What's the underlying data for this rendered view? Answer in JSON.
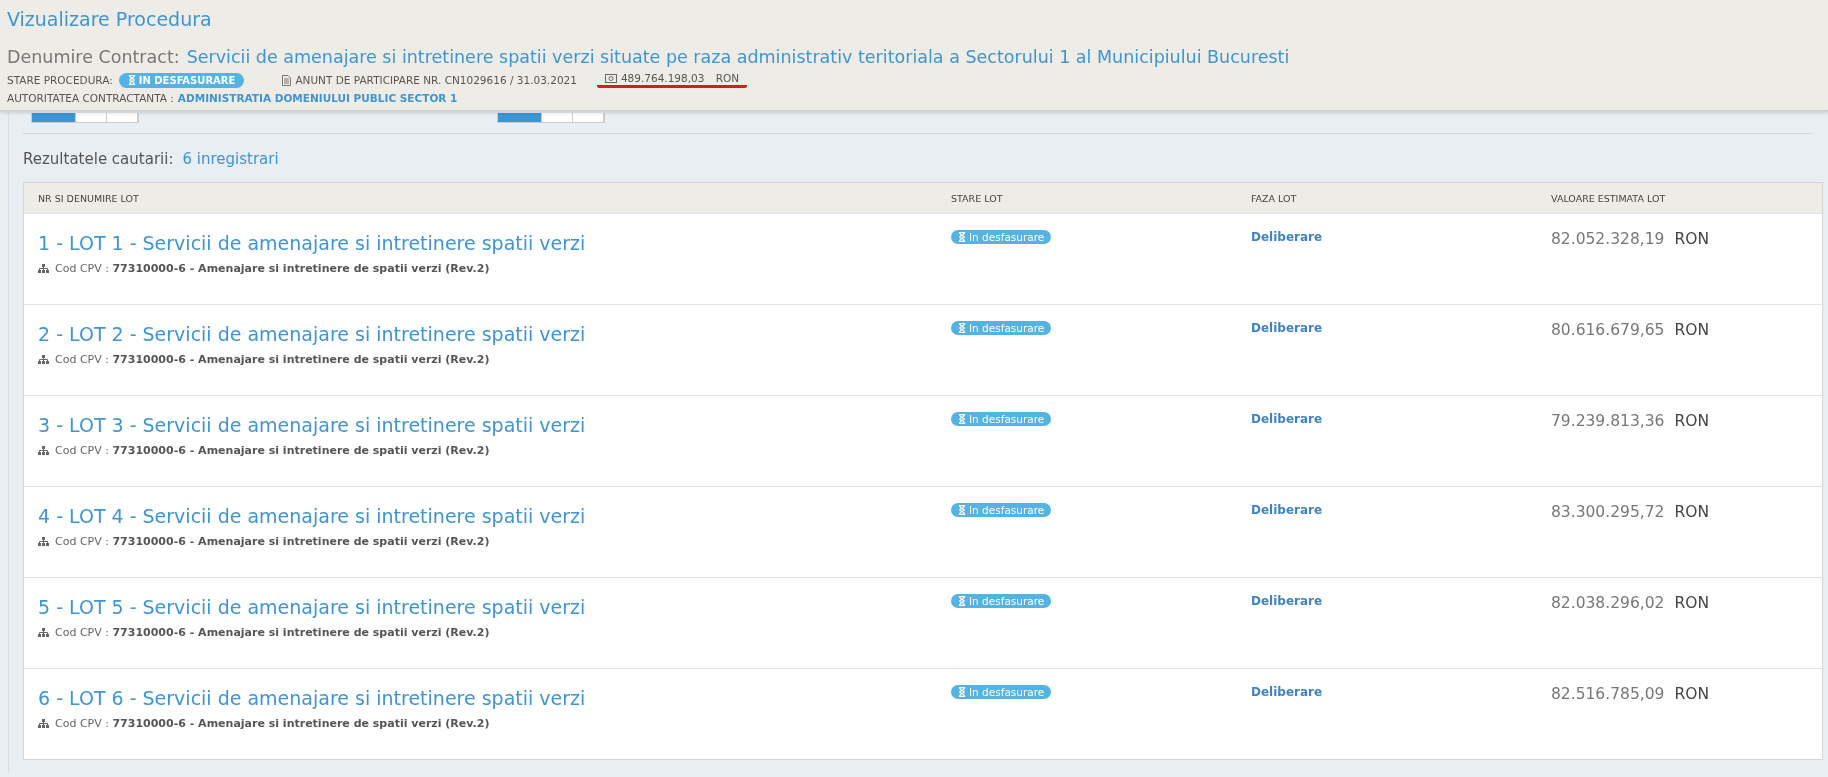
{
  "header": {
    "title": "Vizualizare Procedura",
    "contract_label": "Denumire Contract:",
    "contract_name": "Servicii de amenajare si intretinere spatii verzi situate pe raza administrativ teritoriala a Sectorului 1 al Municipiului Bucuresti",
    "status_label": "STARE PROCEDURA:",
    "status": "IN DESFASURARE",
    "notice": "ANUNT DE PARTICIPARE NR. CN1029616 / 31.03.2021",
    "value": "489.764.198,03",
    "currency": "RON",
    "value_underlined": true,
    "authority_label": "AUTORITATEA CONTRACTANTA :",
    "authority": "ADMINISTRATIA DOMENIULUI PUBLIC SECTOR 1"
  },
  "results": {
    "label": "Rezultatele cautarii:",
    "count": "6 inregistrari"
  },
  "table": {
    "columns": [
      "NR SI DENUMIRE LOT",
      "STARE LOT",
      "FAZA LOT",
      "VALOARE ESTIMATA LOT"
    ],
    "rows": [
      {
        "title": "1 - LOT 1 - Servicii de amenajare si intretinere spatii verzi",
        "cpv": "Cod CPV : **77310000-6 - Amenajare si intretinere de spatii verzi (Rev.2)**",
        "status": "In desfasurare",
        "phase": "Deliberare",
        "value": "82.052.328,19",
        "currency": "RON"
      },
      {
        "title": "2 - LOT 2 - Servicii de amenajare si intretinere spatii verzi",
        "cpv": "Cod CPV : **77310000-6 - Amenajare si intretinere de spatii verzi (Rev.2)**",
        "status": "In desfasurare",
        "phase": "Deliberare",
        "value": "80.616.679,65",
        "currency": "RON"
      },
      {
        "title": "3 - LOT 3 - Servicii de amenajare si intretinere spatii verzi",
        "cpv": "Cod CPV : **77310000-6 - Amenajare si intretinere de spatii verzi (Rev.2)**",
        "status": "In desfasurare",
        "phase": "Deliberare",
        "value": "79.239.813,36",
        "currency": "RON"
      },
      {
        "title": "4 - LOT 4 - Servicii de amenajare si intretinere spatii verzi",
        "cpv": "Cod CPV : **77310000-6 - Amenajare si intretinere de spatii verzi (Rev.2)**",
        "status": "In desfasurare",
        "phase": "Deliberare",
        "value": "83.300.295,72",
        "currency": "RON"
      },
      {
        "title": "5 - LOT 5 - Servicii de amenajare si intretinere spatii verzi",
        "cpv": "Cod CPV : **77310000-6 - Amenajare si intretinere de spatii verzi (Rev.2)**",
        "status": "In desfasurare",
        "phase": "Deliberare",
        "value": "82.038.296,02",
        "currency": "RON"
      },
      {
        "title": "6 - LOT 6 - Servicii de amenajare si intretinere spatii verzi",
        "cpv": "Cod CPV : **77310000-6 - Amenajare si intretinere de spatii verzi (Rev.2)**",
        "status": "In desfasurare",
        "phase": "Deliberare",
        "value": "82.516.785,09",
        "currency": "RON"
      }
    ]
  }
}
